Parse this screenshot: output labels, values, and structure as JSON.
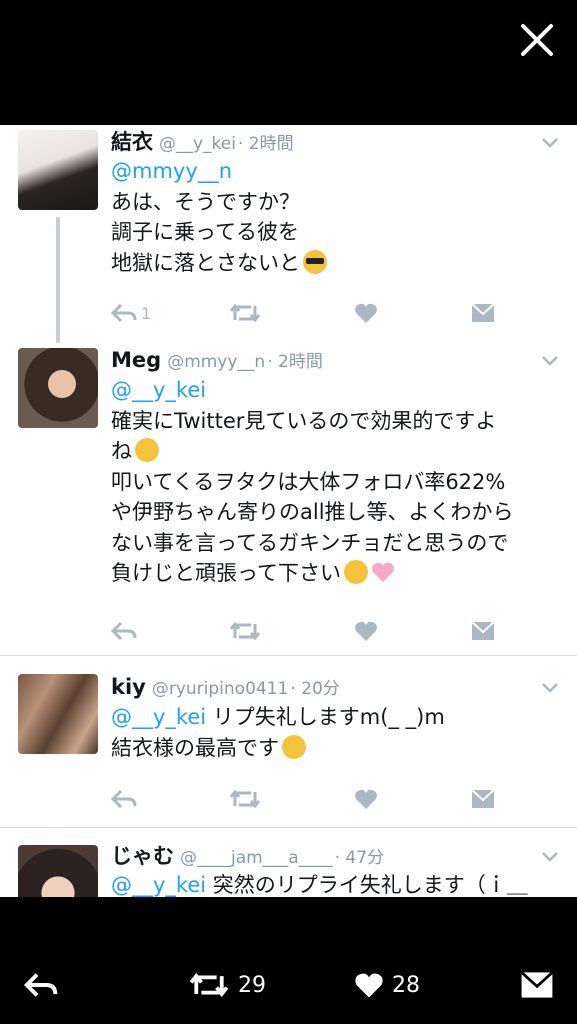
{
  "tweets": [
    {
      "name": "結衣",
      "handle": "@__y_kei",
      "time": "· 2時間",
      "reply_to": "@mmyy__n",
      "lines": [
        "あは、そうですか？",
        "調子に乗ってる彼を",
        "地獄に落とさないと"
      ],
      "emoji": [
        "smiling-face-with-sunglasses"
      ],
      "reply_count": "1"
    },
    {
      "name": "Meg",
      "handle": "@mmyy__n",
      "time": "· 2時間",
      "reply_to": "@__y_kei",
      "lines": [
        "確実にTwitter見ているので効果的ですよ",
        "ね",
        "叩いてくるヲタクは大体フォロバ率622%",
        "や伊野ちゃん寄りのall推し等、よくわから",
        "ない事を言ってるガキンチョだと思うので",
        "負けじと頑張って下さい"
      ],
      "emoji": [
        "hugging-face",
        "smirking-face",
        "pink-heart"
      ]
    },
    {
      "name": "kiy",
      "handle": "@ryuripino0411",
      "time": "· 20分",
      "reply_to": "@__y_kei",
      "first_line_rest": "リプ失礼しますm(_ _)m",
      "lines": [
        "結衣様の最高です"
      ],
      "emoji": [
        "smiling-face"
      ]
    },
    {
      "name": "じゃむ",
      "handle": "@____jam___a____",
      "time": "· 47分",
      "reply_to": "@__y_kei",
      "first_line_rest": "突然のリプライ失礼します（ｉ＿"
    }
  ],
  "bottom_bar": {
    "retweet_count": "29",
    "like_count": "28"
  },
  "colors": {
    "mention": "#1da1f2",
    "meta": "#8899a6",
    "action": "#aab8c2",
    "text": "#14171a"
  }
}
